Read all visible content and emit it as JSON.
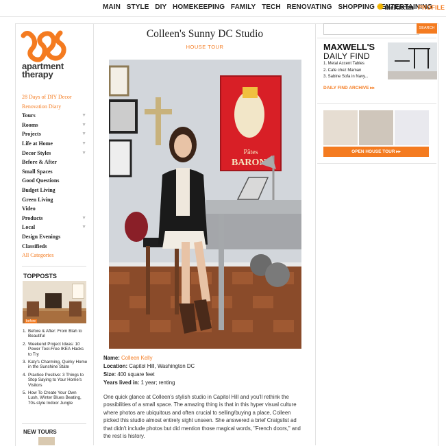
{
  "topnav": {
    "items": [
      "MAIN",
      "STYLE",
      "DIY",
      "HOMEKEEPING",
      "FAMILY",
      "TECH",
      "RENOVATING",
      "SHOPPING",
      "ENTERTAINING"
    ],
    "kitchn": "theKitchn",
    "profile": "PROFILE"
  },
  "brand": {
    "line1": "apartment",
    "line2": "therapy",
    "logo_icon": "apartment-therapy-logo-icon",
    "logo_color": "#f47b20"
  },
  "sidebar": {
    "items": [
      {
        "label": "28 Days of DIY Decor",
        "orange": true,
        "chevron": false
      },
      {
        "label": "Renovation Diary",
        "orange": true,
        "chevron": false
      },
      {
        "label": "Tours",
        "orange": false,
        "chevron": true
      },
      {
        "label": "Rooms",
        "orange": false,
        "chevron": true
      },
      {
        "label": "Projects",
        "orange": false,
        "chevron": true
      },
      {
        "label": "Life at Home",
        "orange": false,
        "chevron": true
      },
      {
        "label": "Decor Styles",
        "orange": false,
        "chevron": true
      },
      {
        "label": "Before & After",
        "orange": false,
        "chevron": false
      },
      {
        "label": "Small Spaces",
        "orange": false,
        "chevron": false
      },
      {
        "label": "Good Questions",
        "orange": false,
        "chevron": false
      },
      {
        "label": "Budget Living",
        "orange": false,
        "chevron": false
      },
      {
        "label": "Green Living",
        "orange": false,
        "chevron": false
      },
      {
        "label": "Video",
        "orange": false,
        "chevron": false
      },
      {
        "label": "Products",
        "orange": false,
        "chevron": true
      },
      {
        "label": "Local",
        "orange": false,
        "chevron": true
      },
      {
        "label": "Design Evenings",
        "orange": false,
        "chevron": false
      },
      {
        "label": "Classifieds",
        "orange": false,
        "chevron": false
      },
      {
        "label": "All Categories",
        "orange": true,
        "chevron": false
      }
    ]
  },
  "top_posts": {
    "heading_bold": "TOP",
    "heading_rest": "POSTS",
    "badge": "before",
    "items": [
      "Before & After: From Blah to Beautiful",
      "Weekend Project Ideas: 10 Power Tool-Free IKEA Hacks to Try",
      "Katy's Charming, Quirky Home in the Sunshine State",
      "Practice Positive: 3 Things to Stop Saying to Your Home's Visitors",
      "How To Create Your Own Lush, Winter Blues Beating, 70s-style Indoor Jungle"
    ]
  },
  "new_tours": {
    "heading": "NEW TOURS"
  },
  "article": {
    "title": "Colleen's Sunny DC Studio",
    "tag": "HOUSE TOUR",
    "poster_line1": "Pâtes",
    "poster_line2": "BARONI",
    "name_label": "Name:",
    "name_value": "Colleen Kelly",
    "location_label": "Location:",
    "location_value": "Capitol Hill, Washington DC",
    "size_label": "Size:",
    "size_value": "400 square feet",
    "years_label": "Years lived in:",
    "years_value": "1 year; renting",
    "body": "One quick glance at Colleen's stylish studio in Capitol Hill and you'll rethink the possibilities of a small space. The amazing thing is that in this hyper visual culture where photos are ubiquitous and often crucial to selling/buying a place, Colleen picked this studio almost entirely sight unseen. She answered a brief Craigslist ad that didn't include photos but did mention those magical words, \"French doors,\" and the rest is history."
  },
  "search": {
    "placeholder": "",
    "button": "SEARCH"
  },
  "daily_find": {
    "title1": "MAXWELL'S",
    "title2": "DAILY FIND",
    "items": [
      "1. Metal Accent Tables",
      "2. Cafe chez Maman",
      "3. Sabine Sofa in Navy..."
    ],
    "archive": "DAILY FIND ARCHIVE ▸▸"
  },
  "open_house": {
    "button": "OPEN HOUSE TOUR ▸▸"
  }
}
